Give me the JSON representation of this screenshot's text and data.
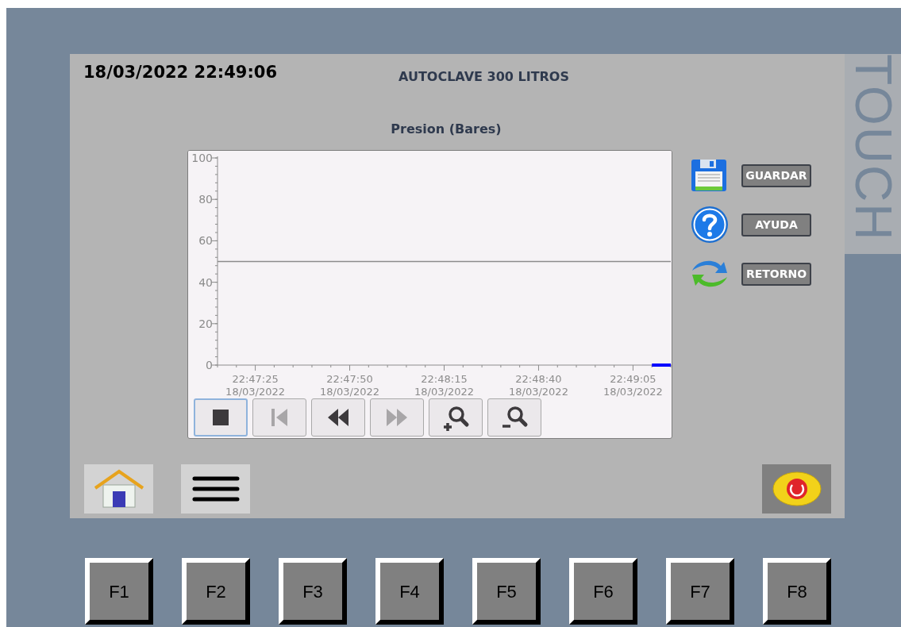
{
  "header": {
    "datetime": "18/03/2022 22:49:06",
    "title": "AUTOCLAVE 300 LITROS"
  },
  "trend": {
    "chart_data": {
      "type": "line",
      "title": "Presion (Bares)",
      "ylim": [
        0,
        100
      ],
      "yticks": [
        0,
        20,
        40,
        60,
        80,
        100
      ],
      "categories": [
        null,
        null,
        "22:47:25\n18/03/2022",
        null,
        null,
        null,
        null,
        "22:47:50\n18/03/2022",
        null,
        null,
        null,
        null,
        "22:48:15\n18/03/2022",
        null,
        null,
        null,
        null,
        "22:48:40\n18/03/2022",
        null,
        null,
        null,
        null,
        "22:49:05\n18/03/2022",
        null,
        null
      ],
      "series": [
        {
          "color": "#0000ff",
          "values": [
            null,
            null,
            null,
            null,
            null,
            null,
            null,
            null,
            null,
            null,
            null,
            null,
            null,
            null,
            null,
            null,
            null,
            null,
            null,
            null,
            null,
            null,
            null,
            0,
            0
          ]
        },
        {
          "color": "#8c8c8c",
          "values": [
            50,
            50,
            50,
            50,
            50,
            50,
            50,
            50,
            50,
            50,
            50,
            50,
            50,
            50,
            50,
            50,
            50,
            50,
            50,
            50,
            50,
            50,
            50,
            50,
            50
          ]
        }
      ]
    },
    "controls": [
      {
        "kind": "stop",
        "selected": true,
        "disabled": false
      },
      {
        "kind": "first",
        "selected": false,
        "disabled": true
      },
      {
        "kind": "back",
        "selected": false,
        "disabled": false
      },
      {
        "kind": "forward",
        "selected": false,
        "disabled": true
      },
      {
        "kind": "zoom-in",
        "selected": false,
        "disabled": false
      },
      {
        "kind": "zoom-out",
        "selected": false,
        "disabled": false
      }
    ]
  },
  "side_buttons": [
    {
      "kind": "save",
      "label": "GUARDAR"
    },
    {
      "kind": "help",
      "label": "AYUDA"
    },
    {
      "kind": "refresh",
      "label": "RETORNO"
    }
  ],
  "bottom_nav": [
    {
      "kind": "home"
    },
    {
      "kind": "menu"
    }
  ],
  "brand": "TOUCH",
  "function_keys": [
    "F1",
    "F2",
    "F3",
    "F4",
    "F5",
    "F6",
    "F7",
    "F8"
  ]
}
